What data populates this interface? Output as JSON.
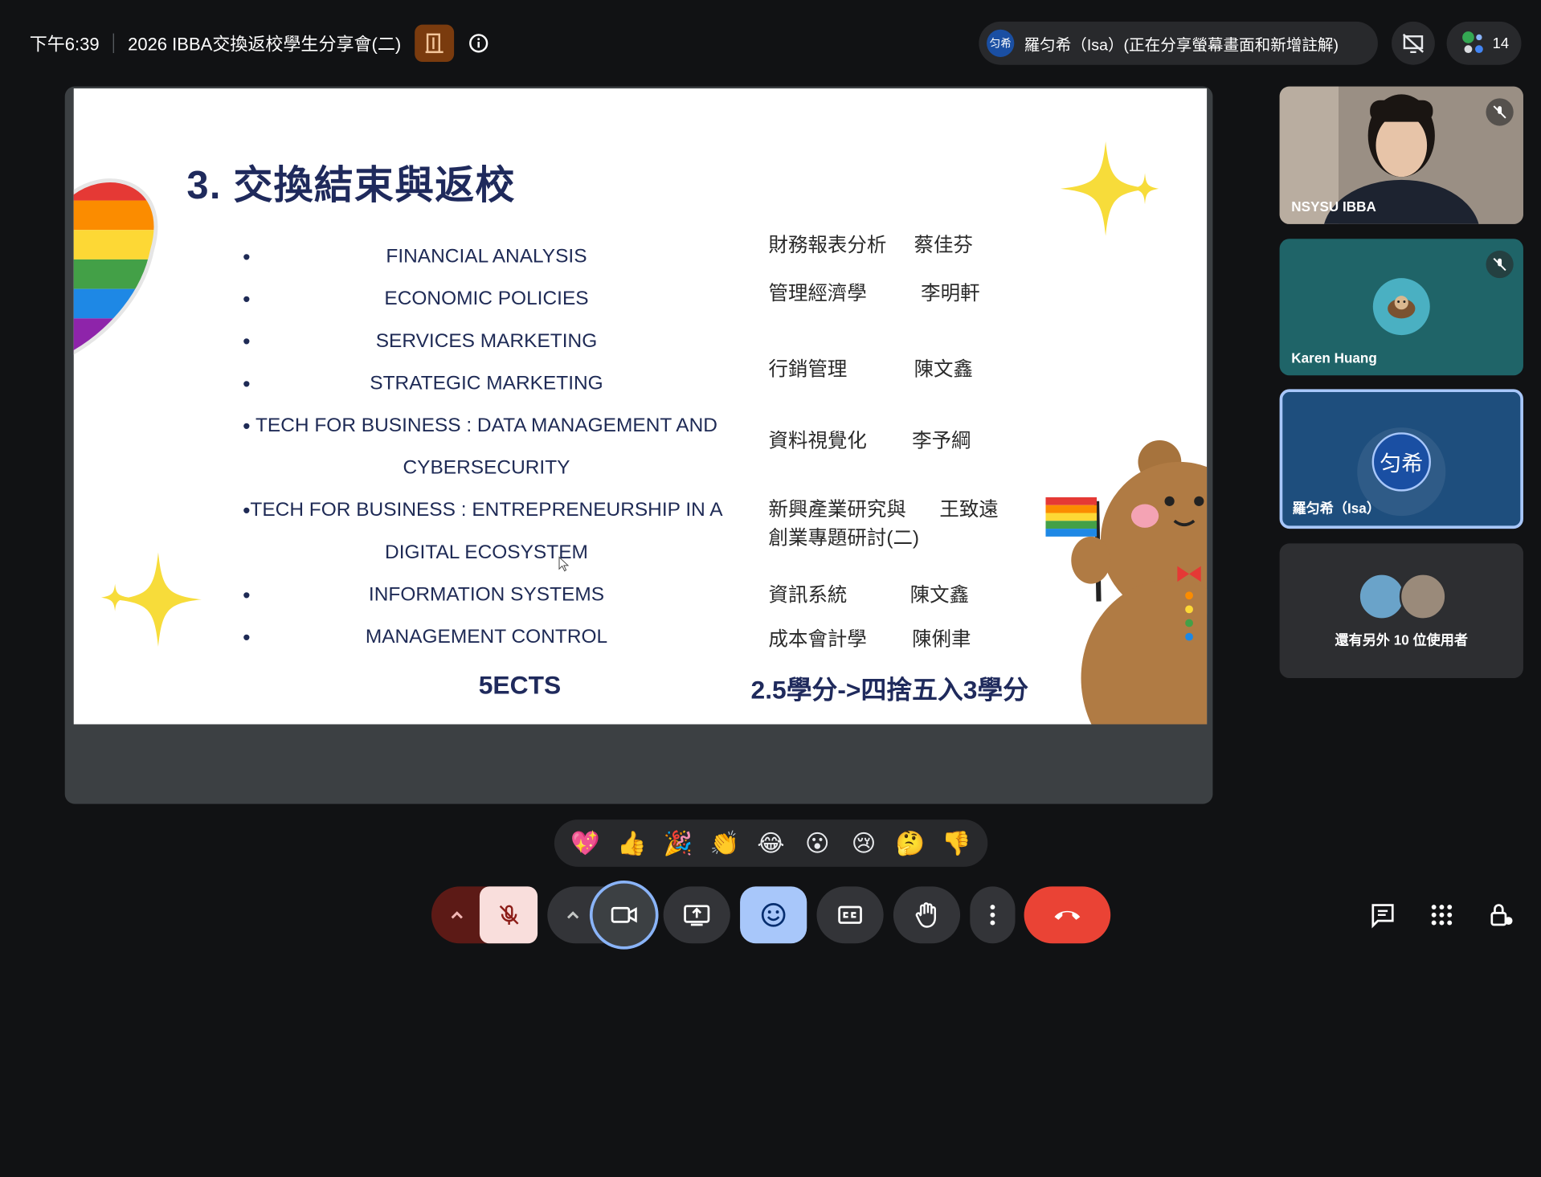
{
  "topbar": {
    "time": "下午6:39",
    "meeting_title": "2026 IBBA交換返校學生分享會(二)"
  },
  "presenter": {
    "avatar_text": "匀希",
    "label": "羅匀希（Isa）(正在分享螢幕畫面和新增註解)"
  },
  "participants_count": "14",
  "slide": {
    "title": "3. 交換結束與返校",
    "courses": [
      "FINANCIAL ANALYSIS",
      "ECONOMIC POLICIES",
      "SERVICES MARKETING",
      "STRATEGIC MARKETING",
      "TECH FOR BUSINESS : DATA MANAGEMENT AND CYBERSECURITY",
      "TECH FOR BUSINESS : ENTREPRENEURSHIP IN A DIGITAL ECOSYSTEM",
      "INFORMATION SYSTEMS",
      "MANAGEMENT CONTROL"
    ],
    "zh_courses": [
      {
        "name": "財務報表分析",
        "teacher": "蔡佳芬"
      },
      {
        "name": "管理經濟學",
        "teacher": "李明軒"
      },
      {
        "name": "行銷管理",
        "teacher": "陳文鑫"
      },
      {
        "name": "資料視覺化",
        "teacher": "李予綱"
      },
      {
        "name": "新興產業研究與",
        "name2": "創業專題研討(二)",
        "teacher": "王致遠"
      },
      {
        "name": "資訊系統",
        "teacher": "陳文鑫"
      },
      {
        "name": "成本會計學",
        "teacher": "陳俐聿"
      }
    ],
    "ects": "5ECTS",
    "credit_note": "2.5學分->四捨五入3學分"
  },
  "tiles": [
    {
      "name": "NSYSU IBBA"
    },
    {
      "name": "Karen Huang"
    },
    {
      "name": "羅匀希（Isa）",
      "avatar_text": "匀希"
    },
    {
      "name": "還有另外 10 位使用者"
    }
  ],
  "reactions": [
    "💖",
    "👍",
    "🎉",
    "👏",
    "😂",
    "😮",
    "😢",
    "🤔",
    "👎"
  ],
  "colors": {
    "background": "#111214",
    "end_call": "#ea4335",
    "emoji_active": "#a8c7fa",
    "mic_off": "#f9dedc"
  }
}
